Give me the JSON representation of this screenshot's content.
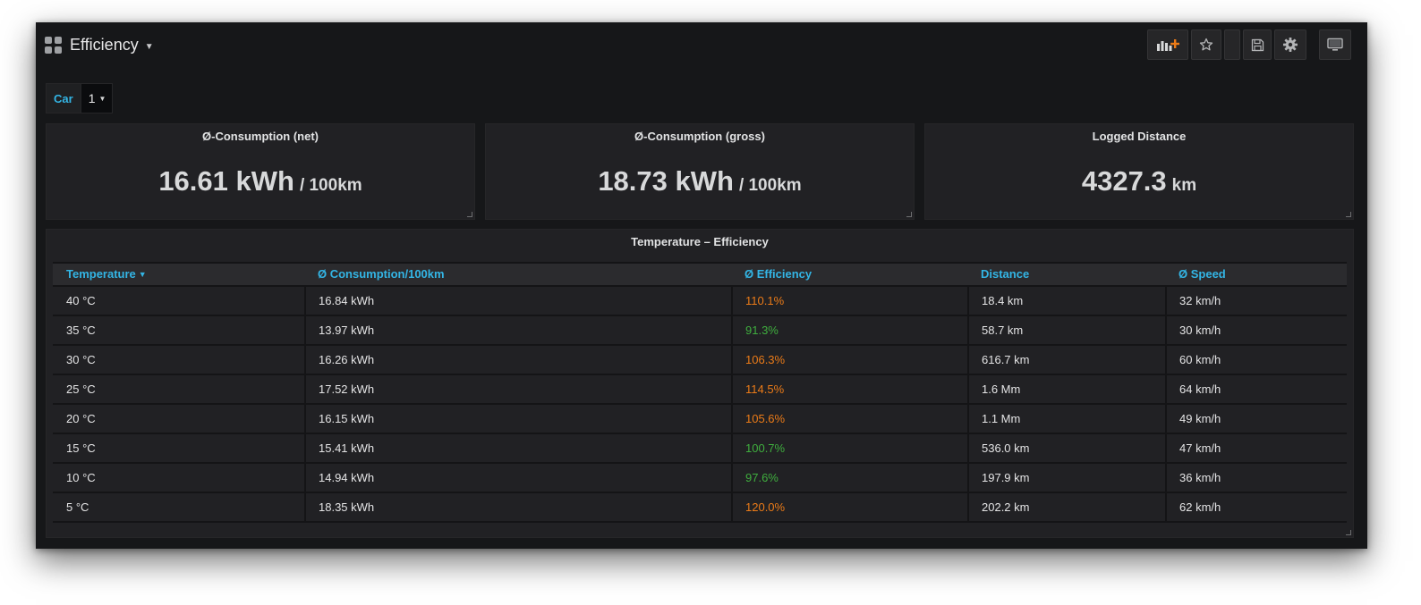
{
  "header": {
    "title": "Efficiency"
  },
  "variables": {
    "car_label": "Car",
    "car_value": "1"
  },
  "stats": [
    {
      "title": "Ø-Consumption (net)",
      "value": "16.61 kWh",
      "unit": "/ 100km"
    },
    {
      "title": "Ø-Consumption (gross)",
      "value": "18.73 kWh",
      "unit": "/ 100km"
    },
    {
      "title": "Logged Distance",
      "value": "4327.3",
      "unit": "km"
    }
  ],
  "table": {
    "title": "Temperature – Efficiency",
    "sorted_column": "Temperature",
    "columns": [
      "Temperature",
      "Ø Consumption/100km",
      "Ø Efficiency",
      "Distance",
      "Ø Speed"
    ],
    "rows": [
      [
        "40 °C",
        "16.84 kWh",
        "110.1%",
        "18.4 km",
        "32 km/h"
      ],
      [
        "35 °C",
        "13.97 kWh",
        "91.3%",
        "58.7 km",
        "30 km/h"
      ],
      [
        "30 °C",
        "16.26 kWh",
        "106.3%",
        "616.7 km",
        "60 km/h"
      ],
      [
        "25 °C",
        "17.52 kWh",
        "114.5%",
        "1.6 Mm",
        "64 km/h"
      ],
      [
        "20 °C",
        "16.15 kWh",
        "105.6%",
        "1.1 Mm",
        "49 km/h"
      ],
      [
        "15 °C",
        "15.41 kWh",
        "100.7%",
        "536.0 km",
        "47 km/h"
      ],
      [
        "10 °C",
        "14.94 kWh",
        "97.6%",
        "197.9 km",
        "36 km/h"
      ],
      [
        "5 °C",
        "18.35 kWh",
        "120.0%",
        "202.2 km",
        "62 km/h"
      ]
    ],
    "efficiency_colors": [
      "orange",
      "green",
      "orange",
      "orange",
      "orange",
      "green",
      "green",
      "orange"
    ]
  },
  "colors": {
    "background": "#161719",
    "panel": "#212124",
    "accent_blue": "#33b5e5",
    "warning_orange": "#eb7b18",
    "ok_green": "#3fae3e"
  },
  "icons": [
    "dashboard-grid-icon",
    "add-panel-icon",
    "star-icon",
    "save-icon",
    "gear-icon",
    "tv-mode-icon"
  ]
}
